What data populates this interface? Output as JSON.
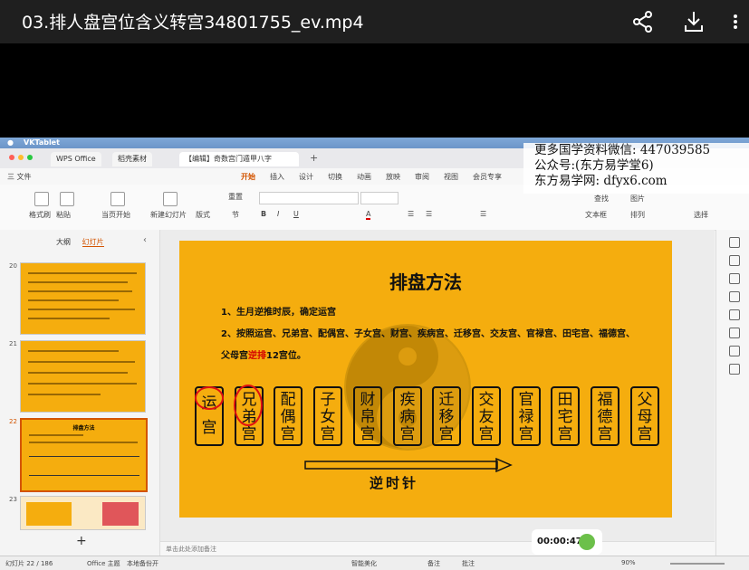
{
  "video": {
    "title": "03.排人盘宫位含义转宫34801755_ev.mp4",
    "share_icon": "share-icon",
    "download_icon": "download-icon",
    "more_icon": "more-vertical-icon",
    "timer": "00:00:47"
  },
  "mac_menu": {
    "app_name": "VKTablet"
  },
  "tabs": [
    {
      "label": "WPS Office"
    },
    {
      "label": "稻壳素材"
    },
    {
      "label": "【编辑】奇数宫门遁甲八字"
    }
  ],
  "menu": {
    "file": "三 文件",
    "items": [
      "开始",
      "插入",
      "设计",
      "切换",
      "动画",
      "放映",
      "审阅",
      "视图",
      "会员专享"
    ]
  },
  "toolbar": {
    "format_painter": "格式刷",
    "paste": "粘贴",
    "start_from_current": "当页开始",
    "new_slide": "新建幻灯片",
    "layout": "版式",
    "section": "节",
    "reset": "重置",
    "shape": "形状",
    "image": "图片",
    "find": "查找",
    "textbox": "文本框",
    "arrange": "排列",
    "select": "选择"
  },
  "watermark": {
    "line1": "更多国学资料微信: 447039585",
    "line2": "公众号:(东方易学堂6)",
    "line3": "东方易学网: dfyx6.com"
  },
  "left_panel": {
    "tab_outline": "大纲",
    "tab_slides": "幻灯片",
    "slide_numbers": [
      "20",
      "21",
      "22",
      "23"
    ],
    "new_slide_plus": "+"
  },
  "slide": {
    "title": "排盘方法",
    "line1": "1、生月逆推时辰，确定运宫",
    "line2": "2、按照运宫、兄弟宫、配偶宫、子女宫、财宫、疾病宫、迁移宫、交友宫、官禄宫、田宅宫、福德宫、",
    "line3_pre": "父母宫",
    "line3_red": "逆排",
    "line3_post": "12宫位。",
    "palaces": [
      {
        "top": "运",
        "bottom": "宫"
      },
      {
        "top": "兄",
        "mid": "弟",
        "bottom": "宫"
      },
      {
        "top": "配",
        "mid": "偶",
        "bottom": "宫"
      },
      {
        "top": "子",
        "mid": "女",
        "bottom": "宫"
      },
      {
        "top": "财",
        "mid": "帛",
        "bottom": "宫"
      },
      {
        "top": "疾",
        "mid": "病",
        "bottom": "宫"
      },
      {
        "top": "迁",
        "mid": "移",
        "bottom": "宫"
      },
      {
        "top": "交",
        "mid": "友",
        "bottom": "宫"
      },
      {
        "top": "官",
        "mid": "禄",
        "bottom": "宫"
      },
      {
        "top": "田",
        "mid": "宅",
        "bottom": "宫"
      },
      {
        "top": "福",
        "mid": "德",
        "bottom": "宫"
      },
      {
        "top": "父",
        "mid": "母",
        "bottom": "宫"
      }
    ],
    "arrow_label": "逆时针"
  },
  "notes_placeholder": "单击此处添加备注",
  "status": {
    "slide_count": "幻灯片 22 / 186",
    "theme": "Office 主题",
    "backup": "本地备份开",
    "smart": "智能美化",
    "notes": "备注",
    "comment": "批注",
    "zoom": "90%"
  }
}
